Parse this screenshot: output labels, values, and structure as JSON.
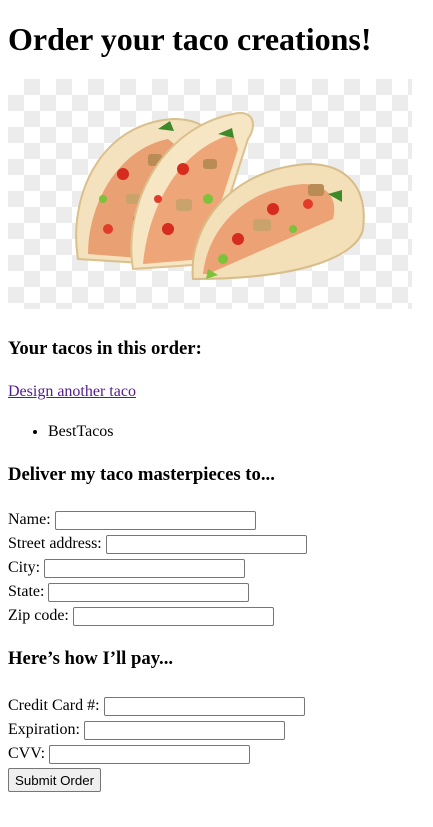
{
  "page": {
    "title": "Order your taco creations!"
  },
  "order": {
    "heading": "Your tacos in this order:",
    "design_link": "Design another taco",
    "tacos": [
      "BestTacos"
    ]
  },
  "delivery": {
    "heading": "Deliver my taco masterpieces to...",
    "fields": {
      "name": {
        "label": "Name:",
        "value": ""
      },
      "street": {
        "label": "Street address:",
        "value": ""
      },
      "city": {
        "label": "City:",
        "value": ""
      },
      "state": {
        "label": "State:",
        "value": ""
      },
      "zip": {
        "label": "Zip code:",
        "value": ""
      }
    }
  },
  "payment": {
    "heading": "Here’s how I’ll pay...",
    "fields": {
      "cc_number": {
        "label": "Credit Card #:",
        "value": ""
      },
      "expiration": {
        "label": "Expiration:",
        "value": ""
      },
      "cvv": {
        "label": "CVV:",
        "value": ""
      }
    },
    "submit_label": "Submit Order"
  },
  "colors": {
    "visited_link": "#551a8b",
    "checker": "#ececec"
  }
}
